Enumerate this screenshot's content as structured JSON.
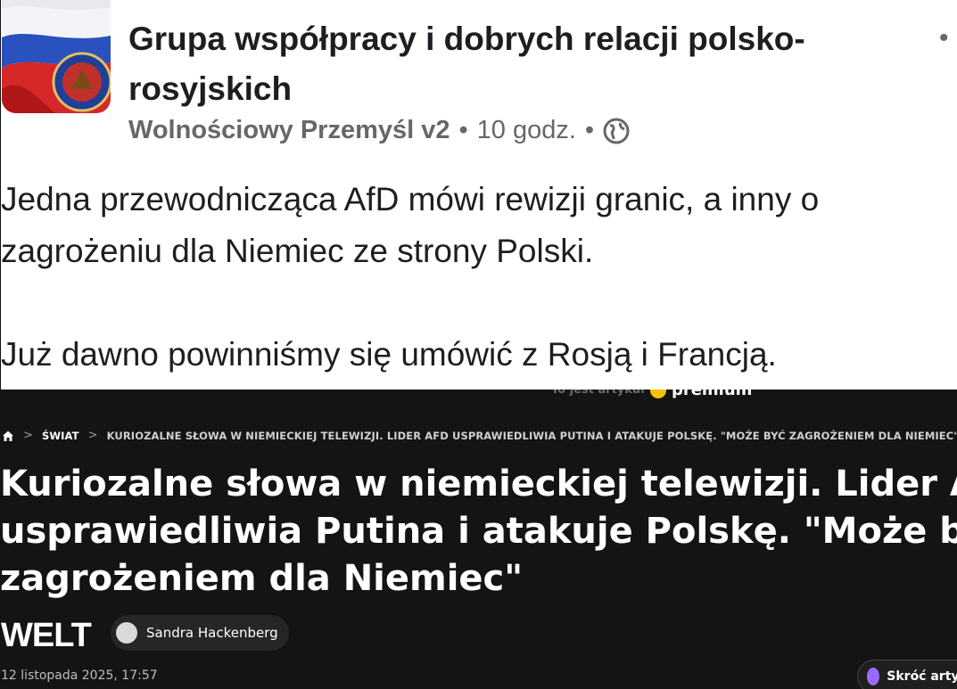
{
  "post": {
    "group_title_line1": "Grupa współpracy i dobrych relacji polsko-",
    "group_title_line2": "rosyjskich",
    "author": "Wolnościowy Przemyśl v2",
    "separator": "•",
    "time": "10 godz.",
    "visibility_icon": "globe-icon",
    "more_icon": "•",
    "text_lines": [
      "Jedna przewodnicząca AfD mówi rewizji granic, a inny o",
      "zagrożeniu dla Niemiec ze strony Polski.",
      "",
      "Już dawno powinniśmy się umówić z Rosją i Francją."
    ]
  },
  "article": {
    "premium_text": "To jest artykuł",
    "premium_label": "premium",
    "breadcrumb": {
      "home_icon": "home-icon",
      "separator": ">",
      "section": "ŚWIAT",
      "title": "KURIOZALNE SŁOWA W NIEMIECKIEJ TELEWIZJI. LIDER AFD USPRAWIEDLIWIA PUTINA I ATAKUJE POLSKĘ. \"MOŻE BYĆ ZAGROŻENIEM DLA NIEMIEC\""
    },
    "headline_lines": [
      "Kuriozalne słowa w niemieckiej telewizji. Lider AfD",
      "usprawiedliwia Putina i atakuje Polskę. \"Może być",
      "zagrożeniem dla Niemiec\""
    ],
    "source_logo": "WELT",
    "author": "Sandra Hackenberg",
    "date": "12 listopada 2025, 17:57",
    "summary_button": "Skróć artykuł"
  },
  "colors": {
    "post_bg": "#ffffff",
    "post_text": "#1c1e21",
    "meta_text": "#65676b",
    "article_bg": "#141414",
    "article_text": "#ffffff",
    "premium_accent": "#f2c300",
    "summary_accent": "#9b6bff"
  }
}
